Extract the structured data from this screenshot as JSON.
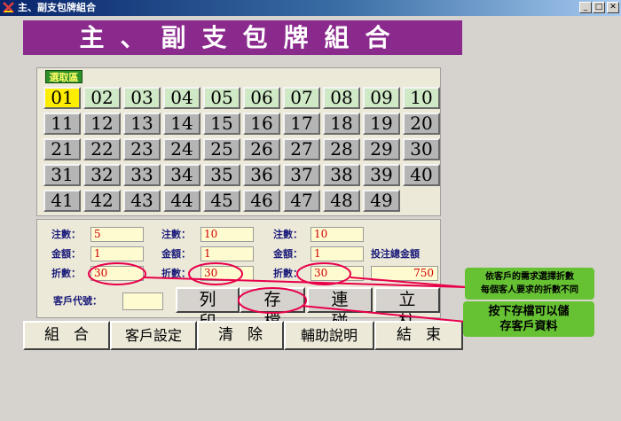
{
  "window": {
    "title": "主、副支包牌組合",
    "minimize_glyph": "_",
    "maximize_glyph": "□",
    "close_glyph": "✕"
  },
  "banner": {
    "text": "主、副支包牌組合"
  },
  "selection": {
    "title": "選取區",
    "selected": "01",
    "numbers": [
      [
        "01",
        "02",
        "03",
        "04",
        "05",
        "06",
        "07",
        "08",
        "09",
        "10"
      ],
      [
        "11",
        "12",
        "13",
        "14",
        "15",
        "16",
        "17",
        "18",
        "19",
        "20"
      ],
      [
        "21",
        "22",
        "23",
        "24",
        "25",
        "26",
        "27",
        "28",
        "29",
        "30"
      ],
      [
        "31",
        "32",
        "33",
        "34",
        "35",
        "36",
        "37",
        "38",
        "39",
        "40"
      ],
      [
        "41",
        "42",
        "43",
        "44",
        "45",
        "46",
        "47",
        "48",
        "49"
      ]
    ]
  },
  "form": {
    "col1": {
      "bet_label": "注數：",
      "bet": "5",
      "amount_label": "金額：",
      "amount": "1",
      "discount_label": "折數：",
      "discount": "30"
    },
    "col2": {
      "bet_label": "注數：",
      "bet": "10",
      "amount_label": "金額：",
      "amount": "1",
      "discount_label": "折數：",
      "discount": "30"
    },
    "col3": {
      "bet_label": "注數：",
      "bet": "10",
      "amount_label": "金額：",
      "amount": "1",
      "discount_label": "折數：",
      "discount": "30"
    },
    "total_label": "投注總金額",
    "total": "750",
    "customer_code_label": "客戶代號：",
    "customer_code": ""
  },
  "actions": {
    "print": "列印",
    "save": "存檔",
    "connect": "連碰",
    "pillar": "立柱"
  },
  "bottom": {
    "combine": "組合",
    "customer_settings": "客戶設定",
    "clear": "清除",
    "help": "輔助說明",
    "end": "結束"
  },
  "callouts": {
    "discount_note_line1": "依客戶的需求選擇折數",
    "discount_note_line2": "每個客人要求的折數不同",
    "save_note_line1": "按下存檔可以儲",
    "save_note_line2": "存客戶資料"
  },
  "colors": {
    "banner": "#8b2a8d",
    "selected": "#ffee00",
    "callout": "#66c233",
    "annotation": "#e8004a"
  }
}
